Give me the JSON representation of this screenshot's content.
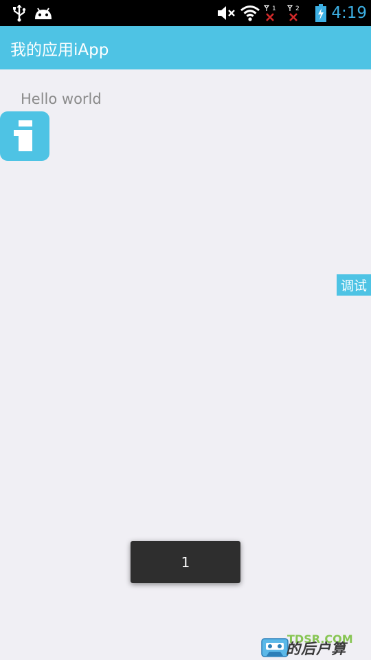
{
  "status_bar": {
    "time": "4:19",
    "time_color": "#3db0e4",
    "icons": [
      "usb-icon",
      "android-icon",
      "mute-icon",
      "wifi-icon",
      "sim1-no-signal-icon",
      "sim2-no-signal-icon",
      "battery-charging-icon"
    ],
    "sim1_label": "1",
    "sim2_label": "2"
  },
  "action_bar": {
    "title": "我的应用iApp",
    "color": "#4ec3e4"
  },
  "main": {
    "hello_text": "Hello world",
    "debug_label": "调试"
  },
  "toast": {
    "text": "1"
  },
  "watermark": {
    "site": "TDSR.COM",
    "text": "的后户算"
  }
}
